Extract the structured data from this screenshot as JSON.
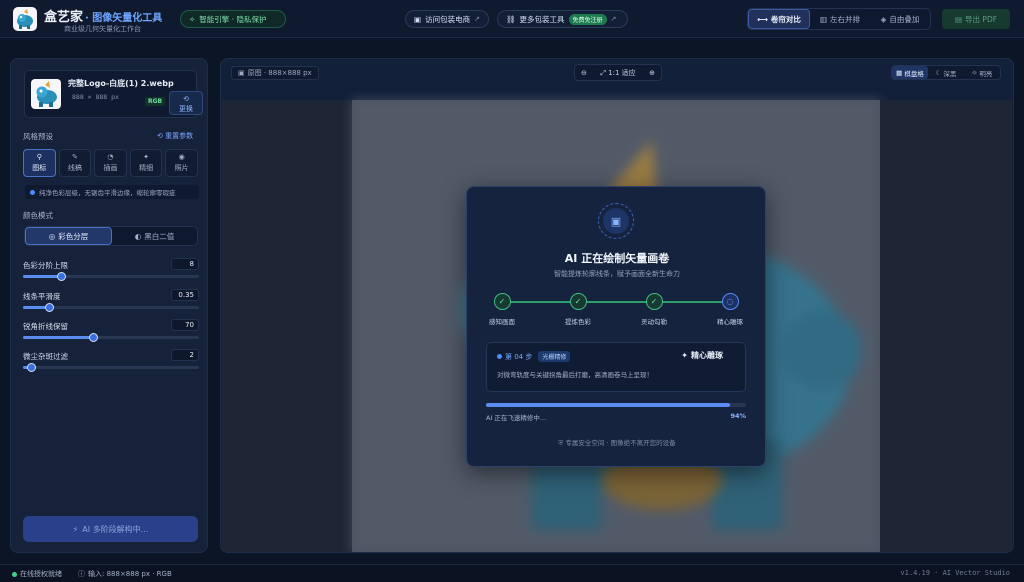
{
  "header": {
    "brand_name": "盒艺家",
    "brand_sub": "· 图像矢量化工具",
    "brand_tagline": "商业级几何矢量化工作台",
    "privacy_pill": "智能引擎 · 隐私保护",
    "store_link": "访问包装电商",
    "tools_link": "更多包装工具",
    "free_badge": "免费免注册",
    "view_modes": [
      {
        "label": "卷帘对比",
        "icon": "split-icon",
        "active": true
      },
      {
        "label": "左右并排",
        "icon": "columns-icon",
        "active": false
      },
      {
        "label": "自由叠加",
        "icon": "layers-icon",
        "active": false
      }
    ],
    "export_label": "导出 PDF"
  },
  "sidebar": {
    "file": {
      "name": "完整Logo-白底(1) 2.webp",
      "size": "888 × 888 px",
      "format": "RGB",
      "replace_label": "更换"
    },
    "style_label": "风格预设",
    "reset_label": "重置参数",
    "presets": [
      {
        "label": "图标",
        "icon": "icon-preset",
        "active": true
      },
      {
        "label": "线稿",
        "icon": "pen-icon",
        "active": false
      },
      {
        "label": "插画",
        "icon": "palette-icon",
        "active": false
      },
      {
        "label": "精细",
        "icon": "sparkle-icon",
        "active": false
      },
      {
        "label": "照片",
        "icon": "camera-icon",
        "active": false
      }
    ],
    "preset_hint": "纯净色彩层级，无锯齿平滑边缘，缩轮廓零瑕疵",
    "color_mode_label": "颜色模式",
    "color_modes": [
      {
        "label": "彩色分层",
        "active": true
      },
      {
        "label": "黑白二值",
        "active": false
      }
    ],
    "sliders": [
      {
        "label": "色彩分阶上限",
        "value": "8",
        "fraction": 0.22
      },
      {
        "label": "线条平滑度",
        "value": "0.35",
        "fraction": 0.15
      },
      {
        "label": "锐角折线保留",
        "value": "70",
        "fraction": 0.4
      },
      {
        "label": "微尘杂斑过滤",
        "value": "2",
        "fraction": 0.05
      }
    ],
    "run_label": "AI 多阶段解构中..."
  },
  "main": {
    "source_badge": "原图 · 888×888 px",
    "zoom_label": "1:1 适应",
    "bg_modes": [
      {
        "label": "棋盘格",
        "active": true
      },
      {
        "label": "深黑",
        "active": false
      },
      {
        "label": "明亮",
        "active": false
      }
    ]
  },
  "modal": {
    "title": "AI 正在绘制矢量画卷",
    "subtitle": "智能提炼轮廓线条，赋予画面全新生命力",
    "steps": [
      {
        "label": "感知画面",
        "done": true
      },
      {
        "label": "提炼色彩",
        "done": true
      },
      {
        "label": "灵动勾勒",
        "done": true
      },
      {
        "label": "精心雕琢",
        "done": false
      }
    ],
    "stage_no": "第 04 步",
    "stage_tag": "光栅精修",
    "stage_name": "精心雕琢",
    "stage_desc": "对微弯轨度与关键拐角最后打磨，高清画卷马上呈现！",
    "progress_text": "AI 正在飞速精修中...",
    "progress_pct": "94%",
    "progress": 0.94,
    "footer": "专属安全空间 · 图像绝不离开您的设备"
  },
  "status": {
    "online": "在线授权就绪",
    "input_info": "输入: 888×888 px · RGB",
    "version": "v1.4.19 · AI Vector Studio"
  }
}
